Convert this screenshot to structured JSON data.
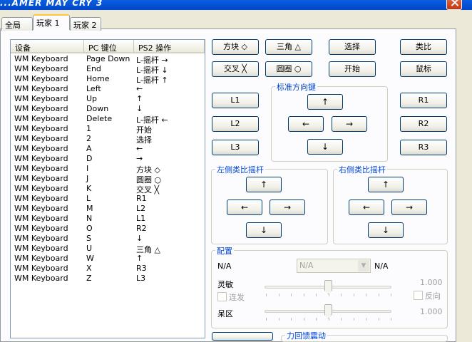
{
  "window": {
    "title": "...AMER MAY CRY 3"
  },
  "tabs": [
    "全局",
    "玩家 1",
    "玩家 2"
  ],
  "list": {
    "columns": [
      "设备",
      "PC 键位",
      "PS2 操作"
    ],
    "rows": [
      [
        "WM Keyboard",
        "Page Down",
        "L-摇杆 →"
      ],
      [
        "WM Keyboard",
        "End",
        "L-摇杆 ↓"
      ],
      [
        "WM Keyboard",
        "Home",
        "L-摇杆 ↑"
      ],
      [
        "WM Keyboard",
        "Left",
        "←"
      ],
      [
        "WM Keyboard",
        "Up",
        "↑"
      ],
      [
        "WM Keyboard",
        "Down",
        "↓"
      ],
      [
        "WM Keyboard",
        "Delete",
        "L-摇杆 ←"
      ],
      [
        "WM Keyboard",
        "1",
        "开始"
      ],
      [
        "WM Keyboard",
        "2",
        "选择"
      ],
      [
        "WM Keyboard",
        "A",
        "←"
      ],
      [
        "WM Keyboard",
        "D",
        "→"
      ],
      [
        "WM Keyboard",
        "I",
        "方块 ◇"
      ],
      [
        "WM Keyboard",
        "J",
        "圆圈 ○"
      ],
      [
        "WM Keyboard",
        "K",
        "交叉 ╳"
      ],
      [
        "WM Keyboard",
        "L",
        "R1"
      ],
      [
        "WM Keyboard",
        "M",
        "L2"
      ],
      [
        "WM Keyboard",
        "N",
        "L1"
      ],
      [
        "WM Keyboard",
        "O",
        "R2"
      ],
      [
        "WM Keyboard",
        "S",
        "↓"
      ],
      [
        "WM Keyboard",
        "U",
        "三角 △"
      ],
      [
        "WM Keyboard",
        "W",
        "↑"
      ],
      [
        "WM Keyboard",
        "X",
        "R3"
      ],
      [
        "WM Keyboard",
        "Z",
        "L3"
      ]
    ]
  },
  "buttons": {
    "square": "方块 ◇",
    "triangle": "三角 △",
    "select": "选择",
    "analog": "类比",
    "cross": "交叉 ╳",
    "circle": "圆圈 ○",
    "start": "开始",
    "mouse": "鼠标",
    "l1": "L1",
    "l2": "L2",
    "l3": "L3",
    "r1": "R1",
    "r2": "R2",
    "r3": "R3",
    "up": "↑",
    "down": "↓",
    "left": "←",
    "right": "→"
  },
  "groups": {
    "dpad": "标准方向键",
    "left_stick": "左侧类比摇杆",
    "right_stick": "右侧类比摇杆",
    "config": "配置",
    "force_feedback": "力回馈震动"
  },
  "config": {
    "device_left": "N/A",
    "combo_value": "N/A",
    "device_right": "N/A",
    "sensitivity_label": "灵敏",
    "sensitivity_value": "1.000",
    "linked_label": "连发",
    "reverse_label": "反向",
    "deadzone_label": "呆区",
    "deadzone_value": "1.000",
    "sensitivity_level": 0.5,
    "deadzone_level": 0.5
  },
  "colors": {
    "titlebar": "#0054e3",
    "group_label": "#0046d5",
    "tab_highlight": "#ffc83c"
  }
}
